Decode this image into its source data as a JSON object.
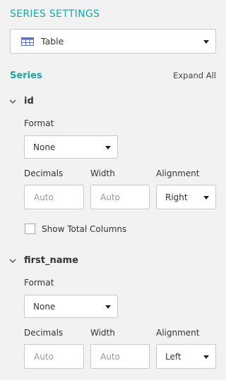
{
  "header": {
    "title": "SERIES SETTINGS"
  },
  "visualization": {
    "selected": "Table",
    "icon": "table-icon"
  },
  "series_section": {
    "title": "Series",
    "expand_all_label": "Expand All"
  },
  "series": [
    {
      "name": "id",
      "format_label": "Format",
      "format_value": "None",
      "decimals_label": "Decimals",
      "decimals_placeholder": "Auto",
      "width_label": "Width",
      "width_placeholder": "Auto",
      "alignment_label": "Alignment",
      "alignment_value": "Right",
      "total_label": "Show Total Columns",
      "total_checked": false
    },
    {
      "name": "first_name",
      "format_label": "Format",
      "format_value": "None",
      "decimals_label": "Decimals",
      "decimals_placeholder": "Auto",
      "width_label": "Width",
      "width_placeholder": "Auto",
      "alignment_label": "Alignment",
      "alignment_value": "Left"
    }
  ],
  "colors": {
    "accent": "#1aa6a6",
    "background": "#f2f2f2",
    "border": "#c9c9c9"
  }
}
